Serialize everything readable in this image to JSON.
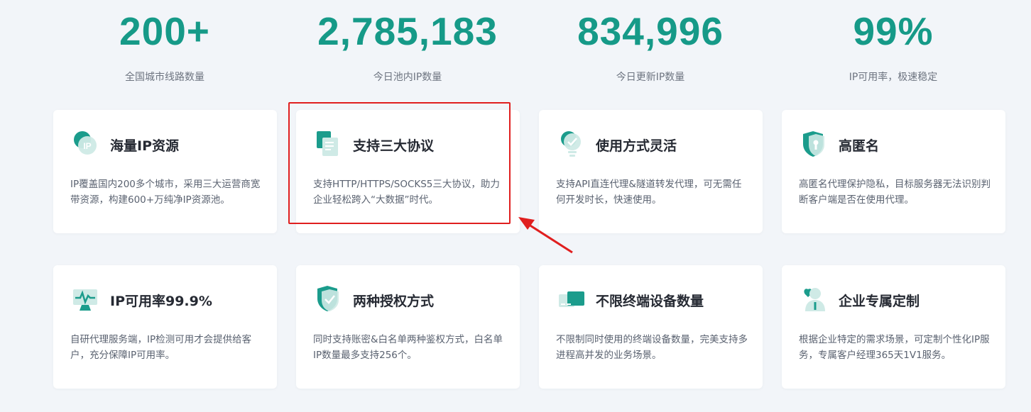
{
  "stats": [
    {
      "value": "200+",
      "label": "全国城市线路数量"
    },
    {
      "value": "2,785,183",
      "label": "今日池内IP数量"
    },
    {
      "value": "834,996",
      "label": "今日更新IP数量"
    },
    {
      "value": "99%",
      "label": "IP可用率，极速稳定"
    }
  ],
  "features": [
    {
      "title": "海量IP资源",
      "desc": "IP覆盖国内200多个城市，采用三大运营商宽带资源，构建600+万纯净IP资源池。",
      "icon": "ip-globe-icon"
    },
    {
      "title": "支持三大协议",
      "desc": "支持HTTP/HTTPS/SOCKS5三大协议，助力企业轻松跨入“大数据”时代。",
      "icon": "protocol-document-icon"
    },
    {
      "title": "使用方式灵活",
      "desc": "支持API直连代理&隧道转发代理，可无需任何开发时长，快速使用。",
      "icon": "lightbulb-icon"
    },
    {
      "title": "高匿名",
      "desc": "高匿名代理保护隐私，目标服务器无法识别判断客户端是否在使用代理。",
      "icon": "shield-lock-icon"
    },
    {
      "title": "IP可用率99.9%",
      "desc": "自研代理服务端，IP检测可用才会提供给客户，充分保障IP可用率。",
      "icon": "monitor-pulse-icon"
    },
    {
      "title": "两种授权方式",
      "desc": "同时支持账密&白名单两种鉴权方式，白名单IP数量最多支持256个。",
      "icon": "shield-check-icon"
    },
    {
      "title": "不限终端设备数量",
      "desc": "不限制同时使用的终端设备数量，完美支持多进程高并发的业务场景。",
      "icon": "devices-icon"
    },
    {
      "title": "企业专属定制",
      "desc": "根据企业特定的需求场景，可定制个性化IP服务，专属客户经理365天1V1服务。",
      "icon": "user-heart-icon"
    }
  ],
  "colors": {
    "accent": "#169a88",
    "highlight": "#e01f1f"
  }
}
